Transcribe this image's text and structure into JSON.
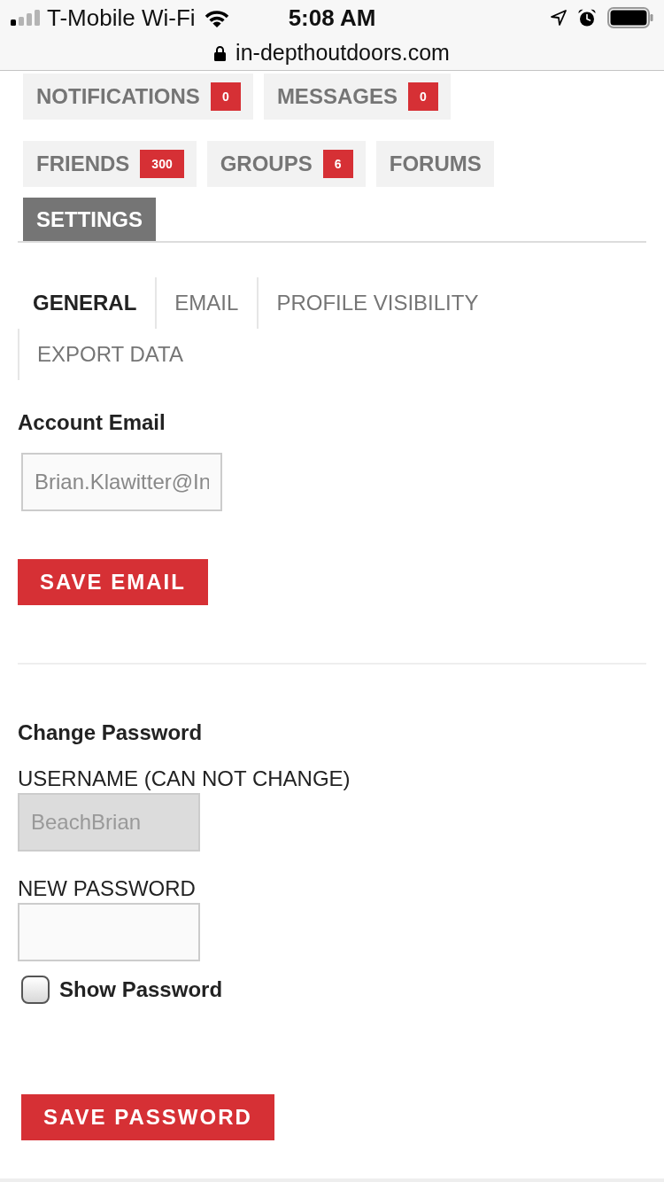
{
  "status_bar": {
    "carrier": "T-Mobile Wi-Fi",
    "time": "5:08 AM"
  },
  "address_bar": {
    "url": "in-depthoutdoors.com"
  },
  "nav_rows": [
    {
      "tabs": [
        {
          "label": "NOTIFICATIONS",
          "badge": "0",
          "selected": false
        },
        {
          "label": "MESSAGES",
          "badge": "0",
          "selected": false
        }
      ]
    },
    {
      "tabs": [
        {
          "label": "FRIENDS",
          "badge": "300",
          "selected": false
        },
        {
          "label": "GROUPS",
          "badge": "6",
          "selected": false
        },
        {
          "label": "FORUMS",
          "selected": false
        }
      ]
    },
    {
      "tabs": [
        {
          "label": "SETTINGS",
          "selected": true
        }
      ]
    }
  ],
  "sub_tabs": [
    {
      "label": "GENERAL",
      "selected": true
    },
    {
      "label": "EMAIL",
      "selected": false
    },
    {
      "label": "PROFILE VISIBILITY",
      "selected": false
    },
    {
      "label": "EXPORT DATA",
      "selected": false
    }
  ],
  "account_email": {
    "heading": "Account Email",
    "field": {
      "value": "Brian.Klawitter@In"
    },
    "button": "SAVE EMAIL"
  },
  "change_password": {
    "heading": "Change Password",
    "fields": [
      {
        "label": "USERNAME (CAN NOT CHANGE)",
        "value": "BeachBrian",
        "disabled": true
      },
      {
        "label": "NEW PASSWORD",
        "disabled": false
      }
    ],
    "show_password": {
      "label": "Show Password",
      "checked": false
    },
    "button": "SAVE PASSWORD"
  }
}
